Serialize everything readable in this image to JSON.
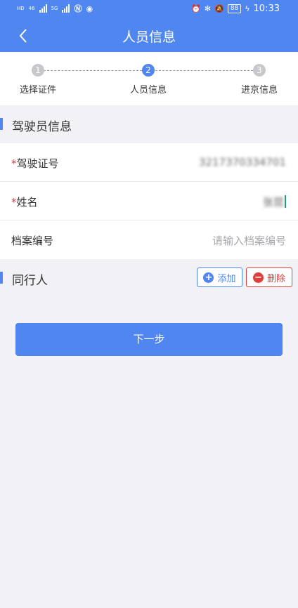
{
  "status_bar": {
    "time": "10:33",
    "battery": "88",
    "net_left_1": "HD",
    "net_left_2": "46",
    "net_left_3": "5G",
    "net_left_4": "HD"
  },
  "nav": {
    "title": "人员信息",
    "back_icon": "chevron-left-icon"
  },
  "steps": [
    {
      "number": "1",
      "label": "选择证件",
      "active": false
    },
    {
      "number": "2",
      "label": "人员信息",
      "active": true
    },
    {
      "number": "3",
      "label": "进京信息",
      "active": false
    }
  ],
  "driver_section": {
    "title": "驾驶员信息"
  },
  "form": {
    "license": {
      "required_mark": "*",
      "label": "驾驶证号",
      "value": "3217370334701"
    },
    "name": {
      "required_mark": "*",
      "label": "姓名",
      "value": "张昆"
    },
    "file_number": {
      "label": "档案编号",
      "placeholder": "请输入档案编号"
    }
  },
  "companion_section": {
    "title": "同行人",
    "add_label": "添加",
    "add_icon": "plus-circle-icon",
    "delete_label": "删除",
    "delete_icon": "minus-circle-icon"
  },
  "next_button": {
    "label": "下一步"
  },
  "colors": {
    "primary": "#4f86f0",
    "danger": "#e0403d",
    "background": "#f2f2f6"
  }
}
